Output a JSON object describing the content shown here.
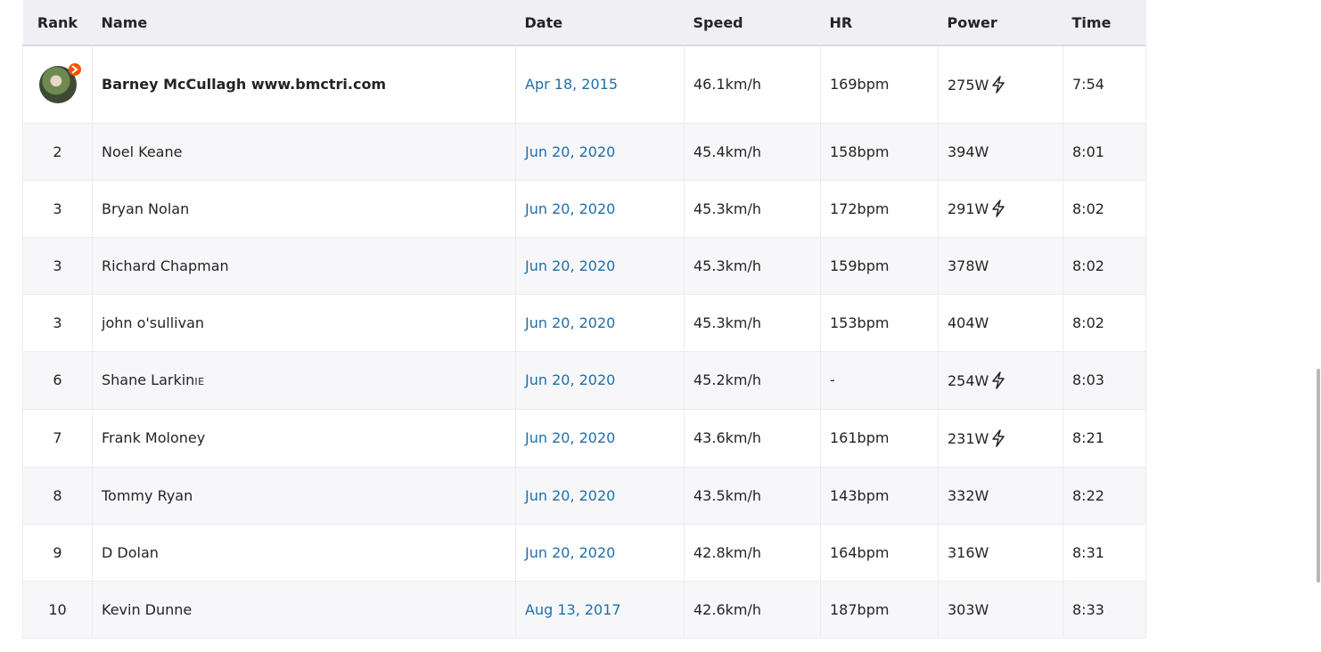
{
  "table": {
    "headers": {
      "rank": "Rank",
      "name": "Name",
      "date": "Date",
      "speed": "Speed",
      "hr": "HR",
      "power": "Power",
      "time": "Time"
    },
    "rows": [
      {
        "rank": "",
        "name": "Barney McCullagh www.bmctri.com",
        "name_suffix": "",
        "date": "Apr 18, 2015",
        "speed": "46.1km/h",
        "hr": "169bpm",
        "power": "275W",
        "power_meter": true,
        "time": "7:54",
        "avatar": true
      },
      {
        "rank": "2",
        "name": "Noel Keane",
        "name_suffix": "",
        "date": "Jun 20, 2020",
        "speed": "45.4km/h",
        "hr": "158bpm",
        "power": "394W",
        "power_meter": false,
        "time": "8:01"
      },
      {
        "rank": "3",
        "name": "Bryan Nolan",
        "name_suffix": "",
        "date": "Jun 20, 2020",
        "speed": "45.3km/h",
        "hr": "172bpm",
        "power": "291W",
        "power_meter": true,
        "time": "8:02"
      },
      {
        "rank": "3",
        "name": "Richard Chapman",
        "name_suffix": "",
        "date": "Jun 20, 2020",
        "speed": "45.3km/h",
        "hr": "159bpm",
        "power": "378W",
        "power_meter": false,
        "time": "8:02"
      },
      {
        "rank": "3",
        "name": "john o'sullivan",
        "name_suffix": "",
        "date": "Jun 20, 2020",
        "speed": "45.3km/h",
        "hr": "153bpm",
        "power": "404W",
        "power_meter": false,
        "time": "8:02"
      },
      {
        "rank": "6",
        "name": "Shane Larkin",
        "name_suffix": "IE",
        "date": "Jun 20, 2020",
        "speed": "45.2km/h",
        "hr": "-",
        "power": "254W",
        "power_meter": true,
        "time": "8:03"
      },
      {
        "rank": "7",
        "name": "Frank Moloney",
        "name_suffix": "",
        "date": "Jun 20, 2020",
        "speed": "43.6km/h",
        "hr": "161bpm",
        "power": "231W",
        "power_meter": true,
        "time": "8:21"
      },
      {
        "rank": "8",
        "name": "Tommy Ryan",
        "name_suffix": "",
        "date": "Jun 20, 2020",
        "speed": "43.5km/h",
        "hr": "143bpm",
        "power": "332W",
        "power_meter": false,
        "time": "8:22"
      },
      {
        "rank": "9",
        "name": "D Dolan",
        "name_suffix": "",
        "date": "Jun 20, 2020",
        "speed": "42.8km/h",
        "hr": "164bpm",
        "power": "316W",
        "power_meter": false,
        "time": "8:31"
      },
      {
        "rank": "10",
        "name": "Kevin Dunne",
        "name_suffix": "",
        "date": "Aug 13, 2017",
        "speed": "42.6km/h",
        "hr": "187bpm",
        "power": "303W",
        "power_meter": false,
        "time": "8:33"
      }
    ]
  },
  "icons": {
    "power_meter": "lightning-bolt-icon",
    "avatar_badge": "kom-crown-icon"
  },
  "colors": {
    "link": "#1f6fa8",
    "header_bg": "#f0f0f4",
    "striped_row_bg": "#f7f7fa",
    "badge": "#fc5200"
  }
}
